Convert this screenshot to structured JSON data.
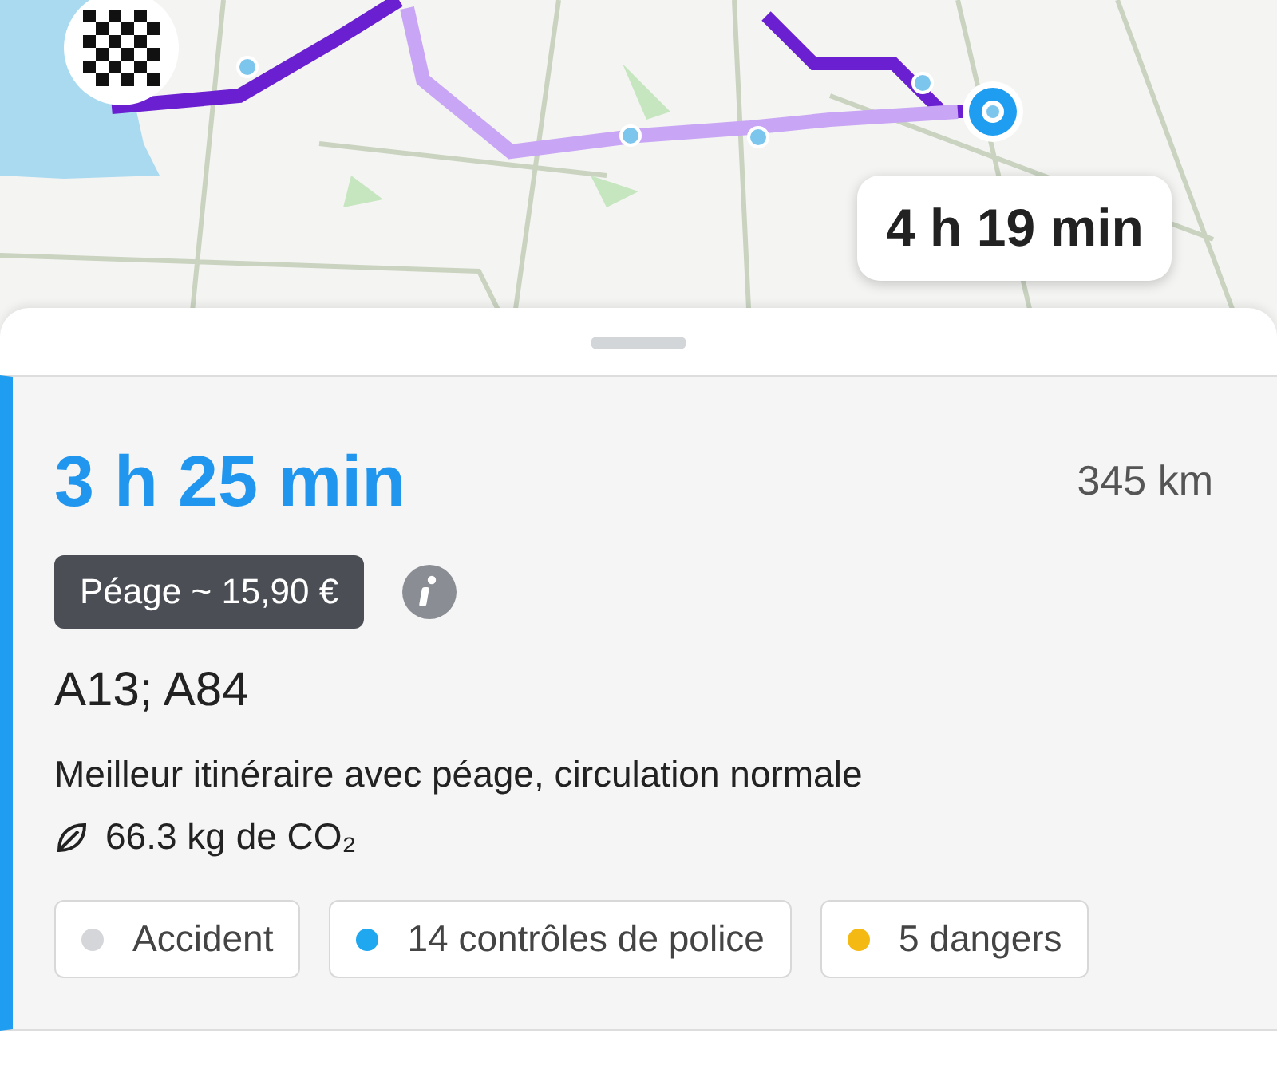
{
  "map": {
    "kind": "picture",
    "alt_route_time": "4 h 19 min"
  },
  "route": {
    "selected": true,
    "duration": "3 h 25 min",
    "distance": "345 km",
    "toll": "Péage ~ 15,90 €",
    "roads": "A13; A84",
    "description": "Meilleur itinéraire avec péage, circulation normale",
    "emissions": "66.3 kg de CO₂",
    "tags": [
      {
        "label": "Accident",
        "color": "#d4d6da"
      },
      {
        "label": "14 contrôles de police",
        "color": "#1fa8f0"
      },
      {
        "label": "5 dangers",
        "color": "#f5b914"
      }
    ]
  }
}
